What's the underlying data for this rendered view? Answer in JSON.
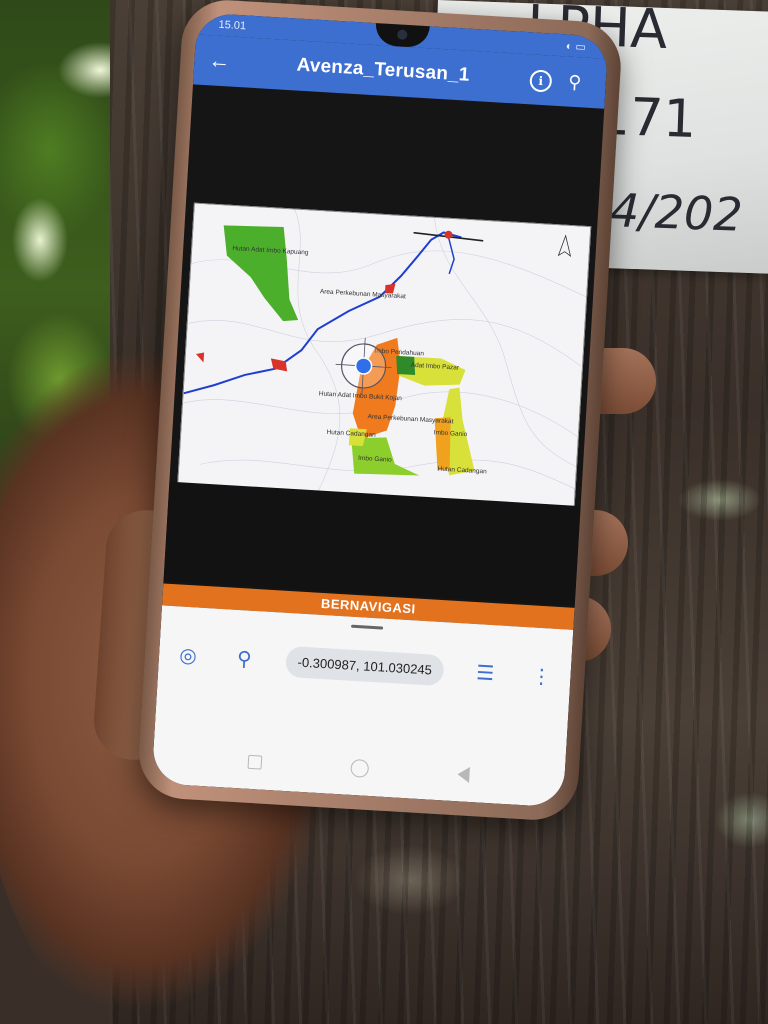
{
  "status_bar": {
    "time": "15.01",
    "icons": "◐ ▭"
  },
  "app_bar": {
    "back_icon": "←",
    "title": "Avenza_Terusan_1",
    "info_icon": "i",
    "search_icon": "⚲"
  },
  "map": {
    "labels": [
      "Hutan Adat Imbo Kapuang",
      "Area Perkebunan Masyarakat",
      "Imbo Pendahuan",
      "Adat Imbo Pazar",
      "Hutan Adat Imbo Bukit Kojan",
      "Area Perkebunan Masyarakat",
      "Imbo Ganio",
      "Hutan Cadangan",
      "Imbo Ganio",
      "Hutan Cadangan"
    ],
    "colors": {
      "green": "#4caf2c",
      "orange": "#f07a1e",
      "yellow": "#d8e03a",
      "river": "#1f3fd0",
      "red": "#d8322a"
    }
  },
  "navigation": {
    "banner": "BERNAVIGASI",
    "coordinates": "-0.300987, 101.030245"
  },
  "bottom_tools": {
    "locate_icon": "◎",
    "pin_icon": "⚲",
    "list_icon": "☰",
    "more_icon": "⋮"
  },
  "tag_text": {
    "line1": "LPHA",
    "line2": "0171",
    "line3": "04/202"
  }
}
